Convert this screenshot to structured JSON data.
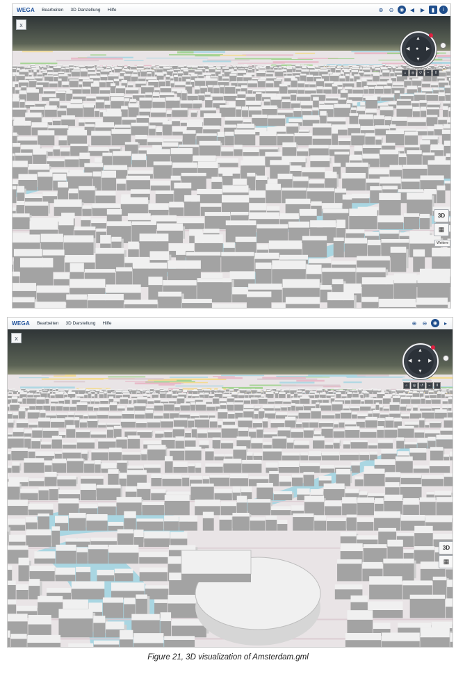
{
  "app": {
    "brand": "WEGA",
    "menu": [
      "Bearbeiten",
      "3D Darstellung",
      "Hilfe"
    ]
  },
  "controls": {
    "close_label": "x",
    "view3d_label": "3D",
    "grid_label": "▦",
    "weitere_label": "Weitere"
  },
  "toolbar_icons": [
    "zoom-in-icon",
    "zoom-out-icon",
    "globe-icon",
    "arrow-left-icon",
    "arrow-right-icon",
    "layers-icon",
    "info-icon"
  ],
  "caption": "Figure 21, 3D visualization of Amsterdam.gml",
  "colors": {
    "sky_top": "#2f3537",
    "sky_horizon": "#8d9178",
    "water": "#a9d6e2",
    "building": "#f0f0f0",
    "building_shadow": "#a3a3a3",
    "road": "#d9c8cf",
    "park": "#a6d88a",
    "brand": "#1c4f9a"
  }
}
